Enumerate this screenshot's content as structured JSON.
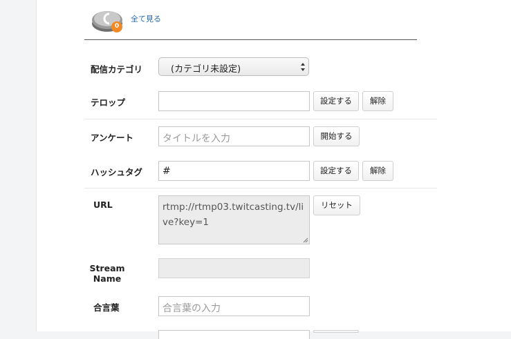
{
  "header": {
    "coin_badge": "0",
    "see_all": "全て見る"
  },
  "form": {
    "category": {
      "label": "配信カテゴリ",
      "selected": "(カテゴリ未設定)"
    },
    "telop": {
      "label": "テロップ",
      "value": "",
      "set_button": "設定する",
      "clear_button": "解除"
    },
    "survey": {
      "label": "アンケート",
      "placeholder": "タイトルを入力",
      "start_button": "開始する"
    },
    "hashtag": {
      "label": "ハッシュタグ",
      "value": "#",
      "set_button": "設定する",
      "clear_button": "解除"
    },
    "url": {
      "label": "URL",
      "value": "rtmp://rtmp03.twitcasting.tv/live?key=1",
      "reset_button": "リセット"
    },
    "stream_name": {
      "label_line1": "Stream",
      "label_line2": "Name",
      "value": ""
    },
    "password": {
      "label": "合言葉",
      "placeholder": "合言葉の入力"
    }
  },
  "colors": {
    "link": "#2b6cb0",
    "coin_badge": "#f08a24"
  }
}
